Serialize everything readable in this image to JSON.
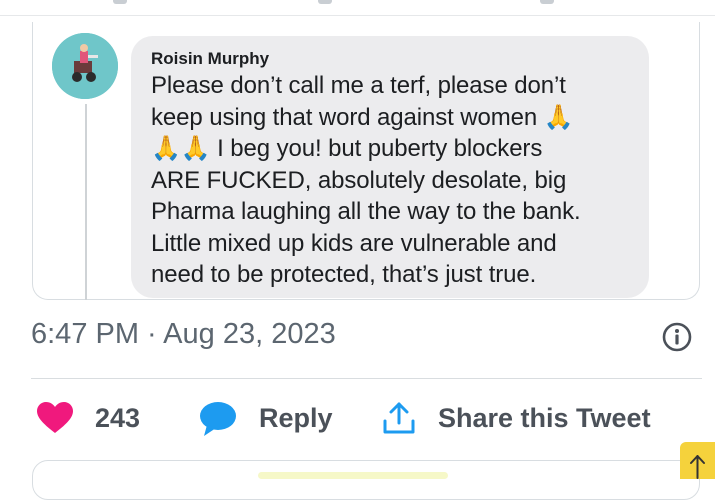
{
  "comment": {
    "author": "Roisin Murphy",
    "line1": "Please don’t call me a terf, please don’t",
    "line2": "keep using that word against women 🙏",
    "line3": "🙏🙏 I beg you! but puberty blockers",
    "line4": "ARE FUCKED, absolutely desolate, big",
    "line5": "Pharma laughing all the way to the bank.",
    "line6": "Little mixed up kids are vulnerable and",
    "line7": "need to be protected, that’s just true."
  },
  "tweet": {
    "timestamp": "6:47 PM · Aug 23, 2023"
  },
  "actions": {
    "like_count": "243",
    "reply_label": "Reply",
    "share_label": "Share this Tweet"
  },
  "colors": {
    "heart": "#f0197d",
    "reply_bubble": "#1d9bf0",
    "share_icon": "#1d9bf0",
    "scroll_button": "#f5d23c",
    "avatar_bg": "#6fc6c9"
  },
  "icons": {
    "like": "heart-icon",
    "reply": "speech-bubble-icon",
    "share": "share-upload-icon",
    "info": "info-icon",
    "scroll": "arrow-up-icon"
  }
}
